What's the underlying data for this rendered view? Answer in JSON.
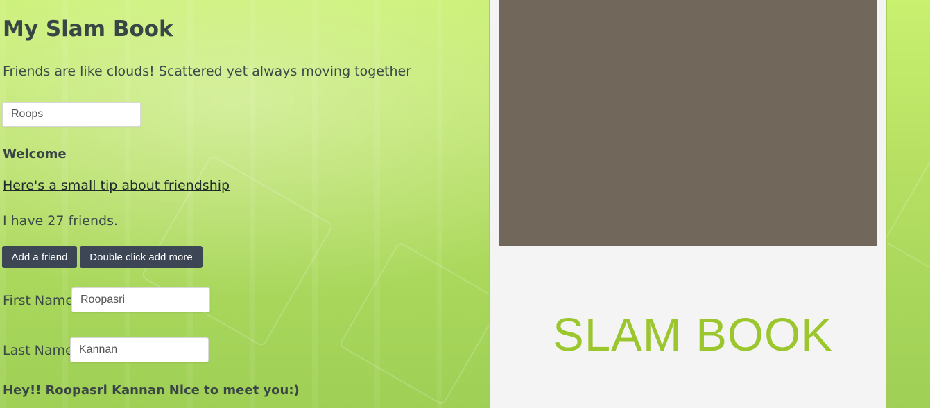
{
  "header": {
    "title": "My Slam Book",
    "tagline": "Friends are like clouds! Scattered yet always moving together"
  },
  "user": {
    "name_value": "Roops",
    "welcome": "Welcome"
  },
  "tip_link": "Here's a small tip about friendship",
  "friends_text": "I have 27 friends.",
  "buttons": {
    "add_friend": "Add a friend",
    "double_click": "Double click add more"
  },
  "form": {
    "first_name_label": "First Name",
    "first_name_value": "Roopasri",
    "last_name_label": "Last Name",
    "last_name_value": "Kannan"
  },
  "greeting": {
    "prefix": "Hey!!",
    "name": "Roopasri Kannan",
    "suffix": "Nice to meet you:)"
  },
  "cover": {
    "text": "SLAM BOOK"
  },
  "colors": {
    "background": "#b7e063",
    "button": "#3d4655",
    "cover_text": "#9bc62e",
    "photo": "#71675a"
  }
}
